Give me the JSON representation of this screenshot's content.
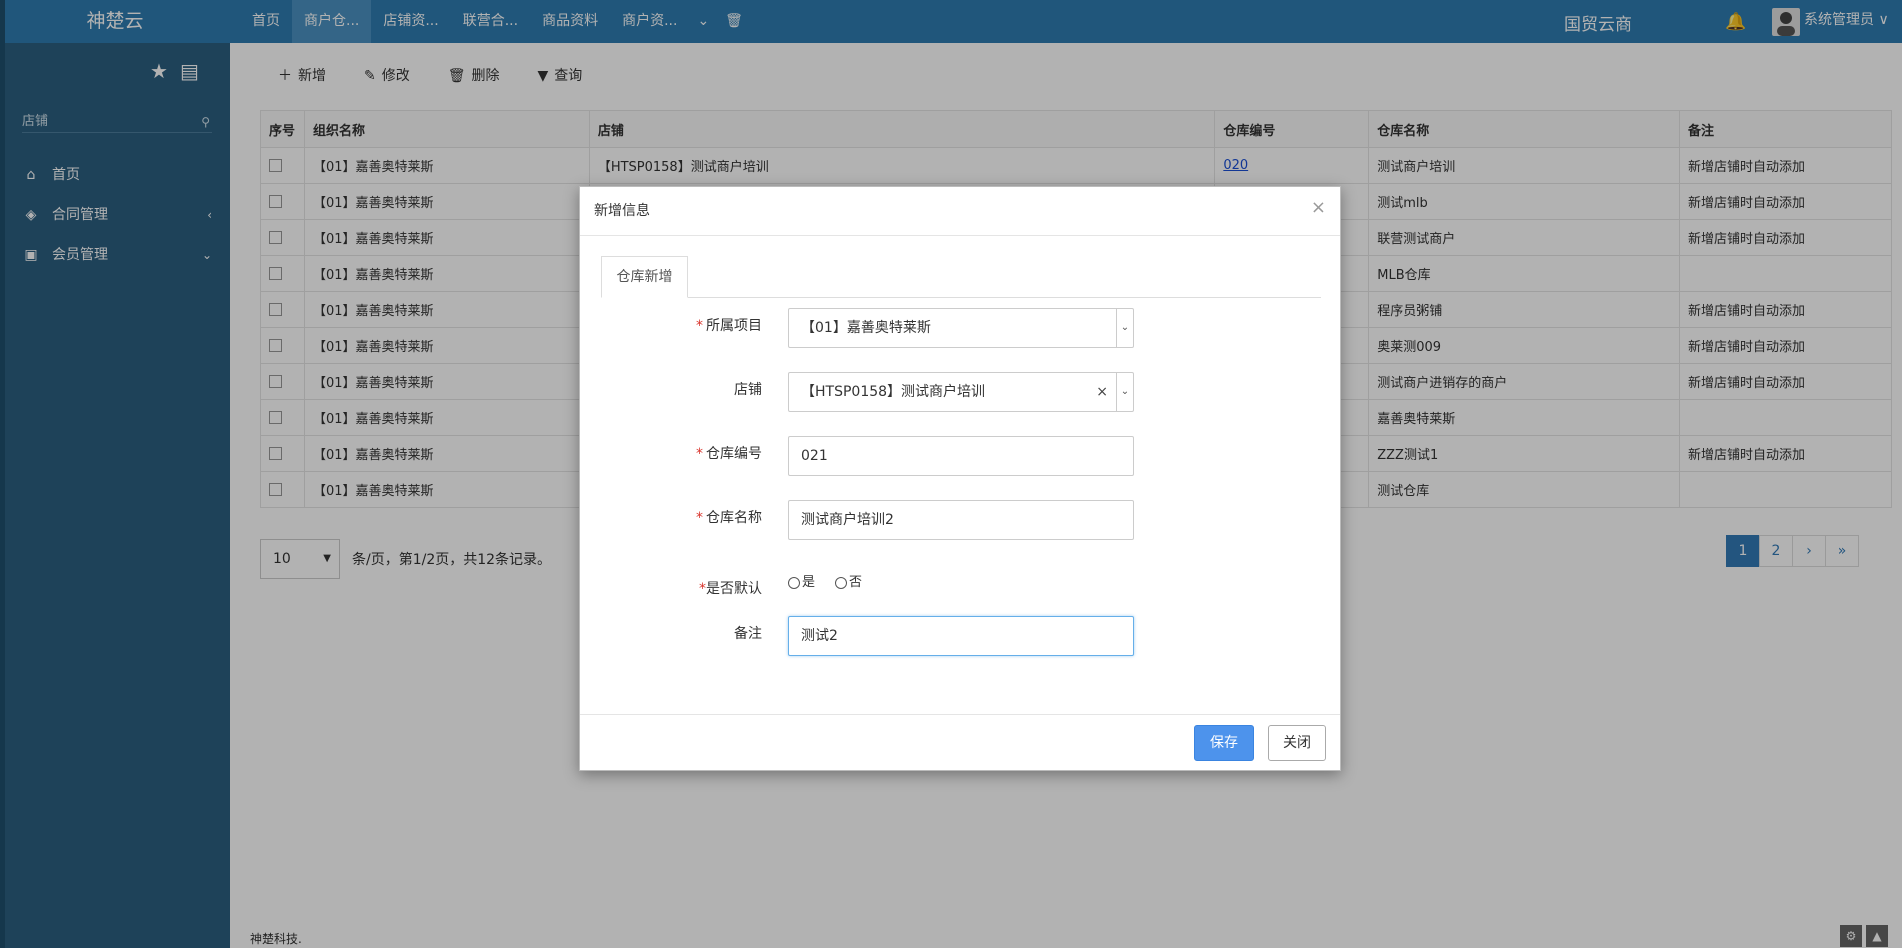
{
  "topbar": {
    "brand": "神楚云",
    "nav": [
      {
        "label": "首页"
      },
      {
        "label": "商户仓..."
      },
      {
        "label": "店铺资..."
      },
      {
        "label": "联营合..."
      },
      {
        "label": "商品资料"
      },
      {
        "label": "商户资..."
      }
    ],
    "brand_right": "国贸云商",
    "user": "系统管理员 ∨"
  },
  "sidebar": {
    "search_text": "店铺",
    "items": [
      {
        "label": "首页",
        "icon": "home-icon"
      },
      {
        "label": "合同管理",
        "icon": "tag-icon"
      },
      {
        "label": "会员管理",
        "icon": "vip-icon"
      }
    ]
  },
  "toolbar": {
    "add": "新增",
    "edit": "修改",
    "delete": "删除",
    "query": "查询"
  },
  "table": {
    "headers": [
      "序号",
      "组织名称",
      "店铺",
      "仓库编号",
      "仓库名称",
      "备注"
    ],
    "rows": [
      {
        "org": "【01】嘉善奥特莱斯",
        "store": "【HTSP0158】测试商户培训",
        "code": "020",
        "name": "测试商户培训",
        "note": "新增店铺时自动添加"
      },
      {
        "org": "【01】嘉善奥特莱斯",
        "store": "",
        "code": "",
        "name": "测试mlb",
        "note": "新增店铺时自动添加"
      },
      {
        "org": "【01】嘉善奥特莱斯",
        "store": "",
        "code": "",
        "name": "联营测试商户",
        "note": "新增店铺时自动添加"
      },
      {
        "org": "【01】嘉善奥特莱斯",
        "store": "",
        "code": "",
        "name": "MLB仓库",
        "note": ""
      },
      {
        "org": "【01】嘉善奥特莱斯",
        "store": "",
        "code": "",
        "name": "程序员粥铺",
        "note": "新增店铺时自动添加"
      },
      {
        "org": "【01】嘉善奥特莱斯",
        "store": "",
        "code": "",
        "name": "奥莱测009",
        "note": "新增店铺时自动添加"
      },
      {
        "org": "【01】嘉善奥特莱斯",
        "store": "",
        "code": "",
        "name": "测试商户进销存的商户",
        "note": "新增店铺时自动添加"
      },
      {
        "org": "【01】嘉善奥特莱斯",
        "store": "",
        "code": "",
        "name": "嘉善奥特莱斯",
        "note": ""
      },
      {
        "org": "【01】嘉善奥特莱斯",
        "store": "",
        "code": "",
        "name": "ZZZ测试1",
        "note": "新增店铺时自动添加"
      },
      {
        "org": "【01】嘉善奥特莱斯",
        "store": "",
        "code": "",
        "name": "测试仓库",
        "note": ""
      }
    ]
  },
  "pager": {
    "page_size": "10",
    "summary": "条/页，第1/2页，共12条记录。",
    "pages": [
      "1",
      "2",
      "›",
      "»"
    ]
  },
  "footer": "神楚科技.",
  "modal": {
    "title": "新增信息",
    "tab": "仓库新增",
    "fields": {
      "project_label": "所属项目",
      "project_value": "【01】嘉善奥特莱斯",
      "store_label": "店铺",
      "store_value": "【HTSP0158】测试商户培训",
      "code_label": "仓库编号",
      "code_value": "021",
      "name_label": "仓库名称",
      "name_value": "测试商户培训2",
      "default_label": "是否默认",
      "default_yes": "是",
      "default_no": "否",
      "note_label": "备注",
      "note_value": "测试2"
    },
    "save": "保存",
    "close": "关闭"
  }
}
